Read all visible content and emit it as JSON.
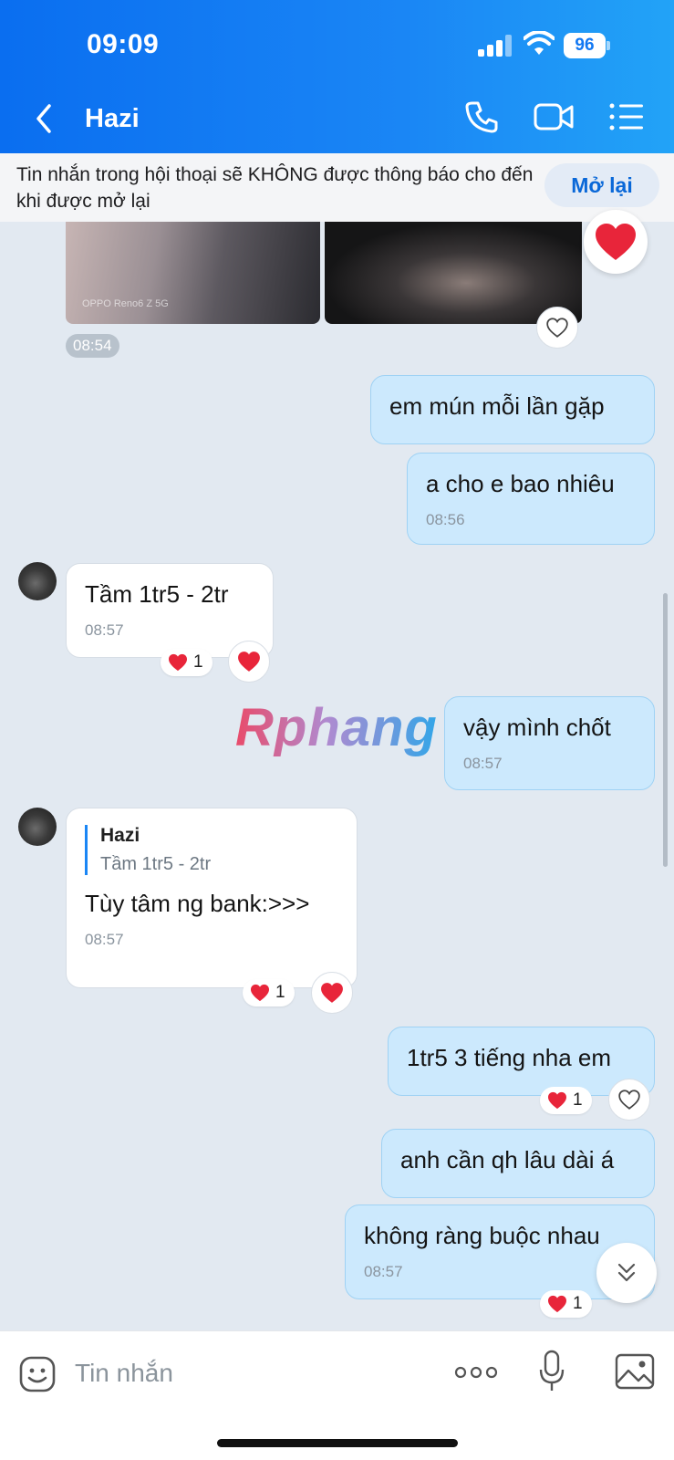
{
  "status_bar": {
    "time": "09:09",
    "battery": "96"
  },
  "header": {
    "title": "Hazi"
  },
  "notice": {
    "text": "Tin nhắn trong hội thoại sẽ KHÔNG được thông báo cho đến khi được mở lại",
    "button": "Mở lại"
  },
  "photos": {
    "caption": "OPPO Reno6 Z 5G",
    "time": "08:54"
  },
  "messages": [
    {
      "dir": "out",
      "text": "em mún mỗi lần gặp",
      "time": ""
    },
    {
      "dir": "out",
      "text": "a cho e bao nhiêu",
      "time": "08:56"
    },
    {
      "dir": "in",
      "text": "Tầm 1tr5 - 2tr",
      "time": "08:57",
      "reactions": "1"
    },
    {
      "dir": "out",
      "text": "vậy mình chốt",
      "time": "08:57"
    },
    {
      "dir": "in",
      "reply_name": "Hazi",
      "reply_text": "Tầm 1tr5 - 2tr",
      "text": "Tùy tâm ng bank:>>>",
      "time": "08:57",
      "reactions": "1"
    },
    {
      "dir": "out",
      "text": "1tr5 3 tiếng nha em",
      "time": "",
      "reactions": "1"
    },
    {
      "dir": "out",
      "text": "anh cần qh lâu dài á",
      "time": ""
    },
    {
      "dir": "out",
      "text": "không ràng buộc nhau",
      "time": "08:57",
      "reactions": "1"
    }
  ],
  "watermark": "Rphang",
  "composer": {
    "placeholder": "Tin nhắn"
  },
  "colors": {
    "header": "#1a86f5",
    "out_bubble": "#cce9fd",
    "in_bubble": "#ffffff",
    "heart": "#e8253a"
  }
}
